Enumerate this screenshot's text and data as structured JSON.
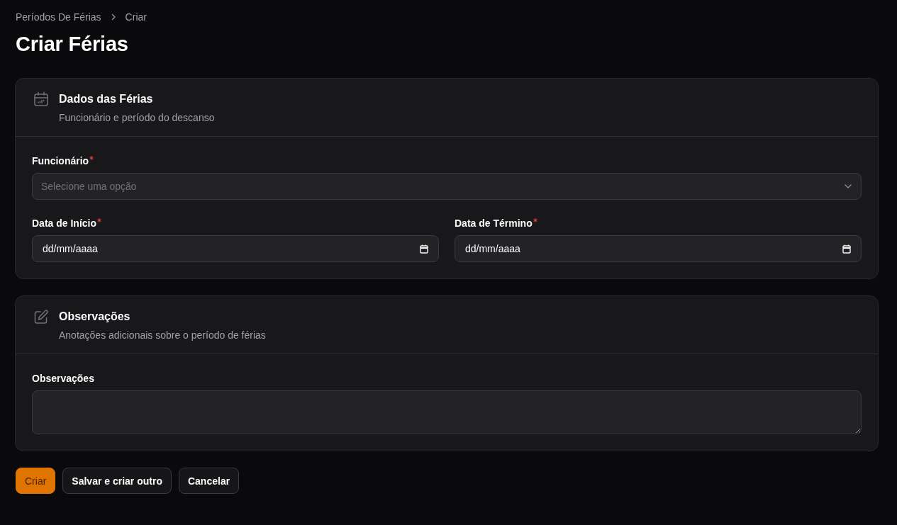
{
  "breadcrumbs": [
    "Períodos De Férias",
    "Criar"
  ],
  "title": "Criar Férias",
  "sections": [
    {
      "title": "Dados das Férias",
      "subtitle": "Funcionário e período do descanso",
      "rows": [
        [
          {
            "kind": "select",
            "label": "Funcionário",
            "required": true,
            "placeholder": "Selecione uma opção"
          }
        ],
        [
          {
            "kind": "date",
            "label": "Data de Início",
            "required": true,
            "placeholder": "dd/mm/aaaa"
          },
          {
            "kind": "date",
            "label": "Data de Término",
            "required": true,
            "placeholder": "dd/mm/aaaa"
          }
        ]
      ]
    },
    {
      "title": "Observações",
      "subtitle": "Anotações adicionais sobre o período de férias",
      "rows": [
        [
          {
            "kind": "textarea",
            "label": "Observações",
            "required": false
          }
        ]
      ]
    }
  ],
  "buttons": [
    {
      "label": "Criar",
      "kind": "primary"
    },
    {
      "label": "Salvar e criar outro",
      "kind": "secondary"
    },
    {
      "label": "Cancelar",
      "kind": "secondary"
    }
  ]
}
